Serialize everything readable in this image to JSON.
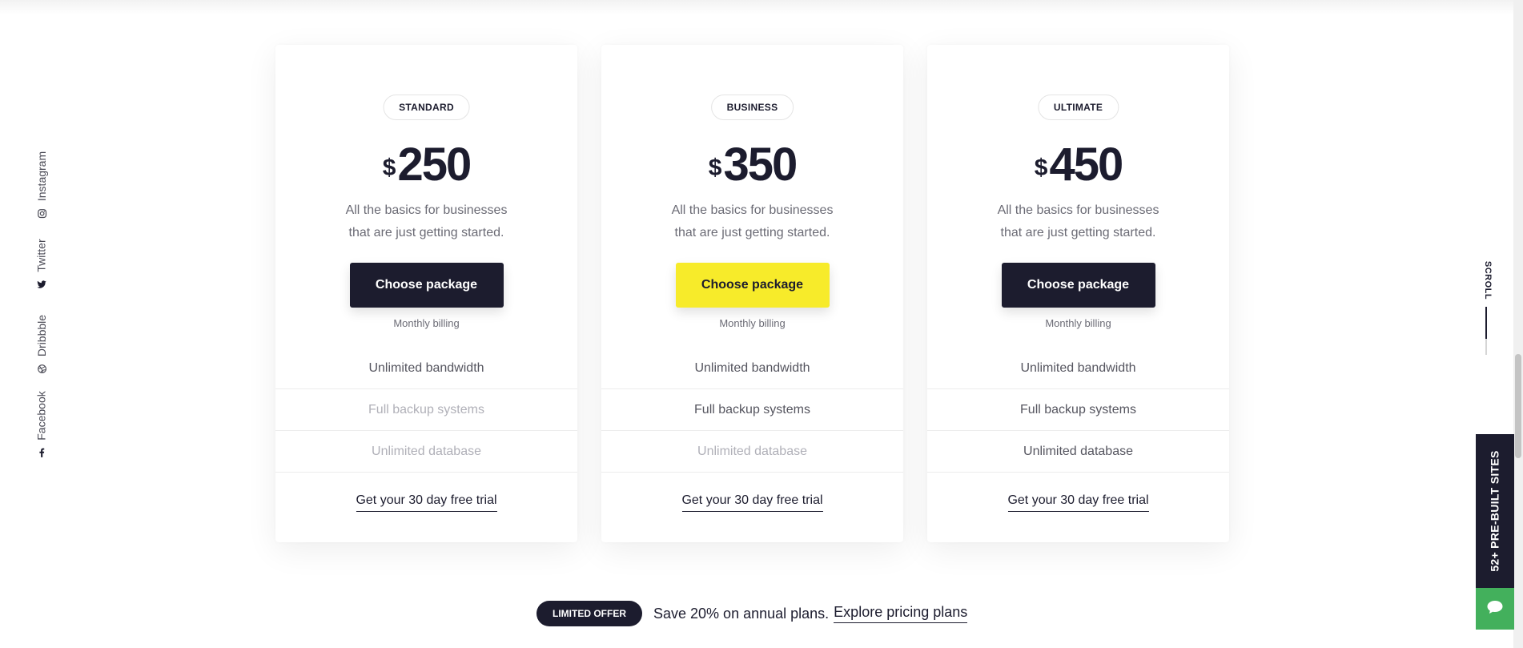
{
  "social": [
    {
      "label": "Instagram",
      "icon": "instagram-icon"
    },
    {
      "label": "Twitter",
      "icon": "twitter-icon"
    },
    {
      "label": "Dribbble",
      "icon": "dribbble-icon"
    },
    {
      "label": "Facebook",
      "icon": "facebook-icon"
    }
  ],
  "rail": {
    "scroll_label": "SCROLL",
    "prebuilt_label": "52+ PRE-BUILT SITES",
    "chat_icon": "chat-icon"
  },
  "plans": [
    {
      "badge": "STANDARD",
      "currency": "$",
      "price": "250",
      "description_line1": "All the basics for businesses",
      "description_line2": "that are just getting started.",
      "button": "Choose package",
      "button_style": "dark",
      "billing": "Monthly billing",
      "features": [
        {
          "label": "Unlimited bandwidth",
          "included": true
        },
        {
          "label": "Full backup systems",
          "included": false
        },
        {
          "label": "Unlimited database",
          "included": false
        }
      ],
      "trial": "Get your 30 day free trial"
    },
    {
      "badge": "BUSINESS",
      "currency": "$",
      "price": "350",
      "description_line1": "All the basics for businesses",
      "description_line2": "that are just getting started.",
      "button": "Choose package",
      "button_style": "yellow",
      "billing": "Monthly billing",
      "features": [
        {
          "label": "Unlimited bandwidth",
          "included": true
        },
        {
          "label": "Full backup systems",
          "included": true
        },
        {
          "label": "Unlimited database",
          "included": false
        }
      ],
      "trial": "Get your 30 day free trial"
    },
    {
      "badge": "ULTIMATE",
      "currency": "$",
      "price": "450",
      "description_line1": "All the basics for businesses",
      "description_line2": "that are just getting started.",
      "button": "Choose package",
      "button_style": "dark",
      "billing": "Monthly billing",
      "features": [
        {
          "label": "Unlimited bandwidth",
          "included": true
        },
        {
          "label": "Full backup systems",
          "included": true
        },
        {
          "label": "Unlimited database",
          "included": true
        }
      ],
      "trial": "Get your 30 day free trial"
    }
  ],
  "offer": {
    "badge": "LIMITED OFFER",
    "text": "Save 20% on annual plans.",
    "link": "Explore pricing plans"
  },
  "colors": {
    "dark": "#1c1c2e",
    "accent_yellow": "#f7eb2a",
    "chat_green": "#43b05c"
  }
}
